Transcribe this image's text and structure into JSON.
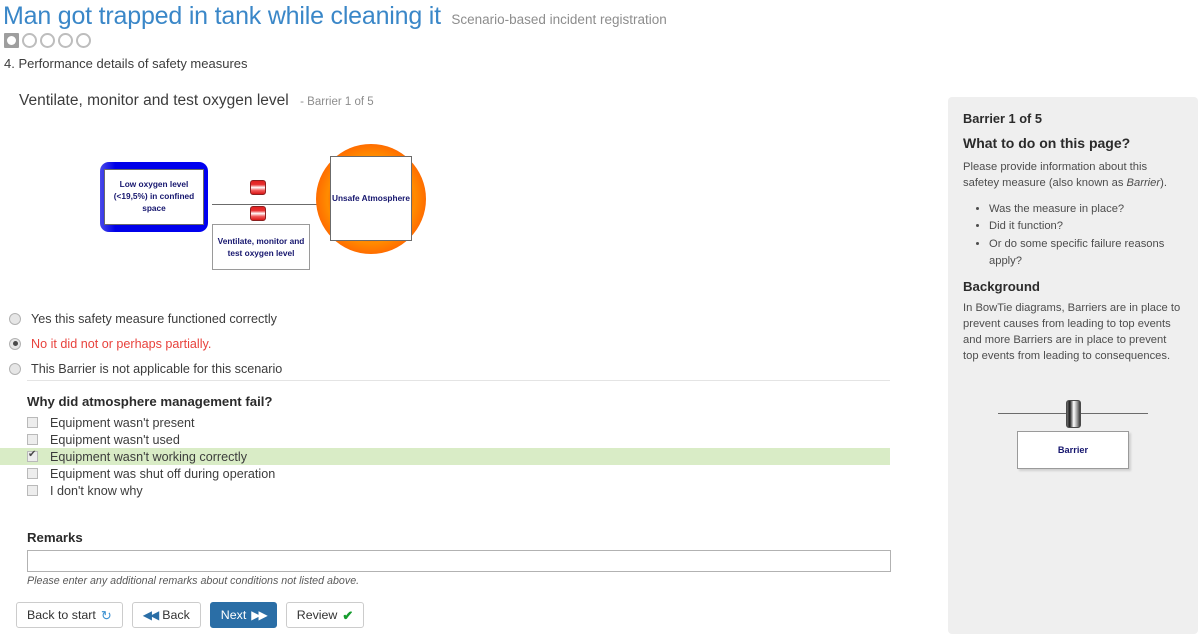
{
  "header": {
    "title": "Man got trapped in tank while cleaning it",
    "subtitle": "Scenario-based incident registration",
    "step_label": "4. Performance details of safety measures",
    "progress": {
      "total": 5,
      "active_index": 0
    }
  },
  "barrier_section": {
    "name": "Ventilate, monitor and test oxygen level",
    "count_label": "- Barrier 1 of 5"
  },
  "diagram": {
    "cause_label": "Low oxygen level (<19,5%) in confined space",
    "measure_label": "Ventilate, monitor and test oxygen level",
    "event_label": "Unsafe Atmosphere",
    "colors": {
      "cause_box": "#0000e8",
      "event_circle": "#ff3300",
      "barrier_chip": "#e02020",
      "text": "#16166e"
    }
  },
  "performance_options": [
    {
      "label": "Yes this safety measure functioned correctly",
      "selected": false,
      "danger": false
    },
    {
      "label": "No it did not or perhaps partially.",
      "selected": true,
      "danger": true
    },
    {
      "label": "This Barrier is not applicable for this scenario",
      "selected": false,
      "danger": false
    }
  ],
  "failure_question": {
    "title": "Why did atmosphere management fail?",
    "options": [
      {
        "label": "Equipment wasn't present",
        "checked": false
      },
      {
        "label": "Equipment wasn't used",
        "checked": false
      },
      {
        "label": "Equipment wasn't working correctly",
        "checked": true
      },
      {
        "label": "Equipment was shut off during operation",
        "checked": false
      },
      {
        "label": "I don't know why",
        "checked": false
      }
    ]
  },
  "remarks": {
    "title": "Remarks",
    "value": "",
    "placeholder": "",
    "hint": "Please enter any additional remarks about conditions not listed above."
  },
  "buttons": [
    {
      "label": "Back to start",
      "icon": "refresh-icon",
      "glyph": "↻",
      "primary": false
    },
    {
      "label": "Back",
      "icon": "double-left-arrow-icon",
      "glyph": "◀◀",
      "primary": false,
      "icon_first": true
    },
    {
      "label": "Next",
      "icon": "double-right-arrow-icon",
      "glyph": "▶▶",
      "primary": true
    },
    {
      "label": "Review",
      "icon": "check-icon",
      "glyph": "✔",
      "primary": false
    }
  ],
  "sidebar": {
    "barrier_count": "Barrier 1 of 5",
    "what_heading": "What to do on this page?",
    "what_text_part1": "Please provide information about this safetey measure (also known as ",
    "what_text_italic": "Barrier",
    "what_text_part2": ").",
    "bullets": [
      "Was the measure in place?",
      "Did it function?",
      "Or do some specific failure reasons apply?"
    ],
    "background_heading": "Background",
    "background_text": "In BowTie diagrams, Barriers are in place to prevent causes from leading to top events and more Barriers are in place to prevent top events from leading to consequences.",
    "diagram_label": "Barrier"
  }
}
